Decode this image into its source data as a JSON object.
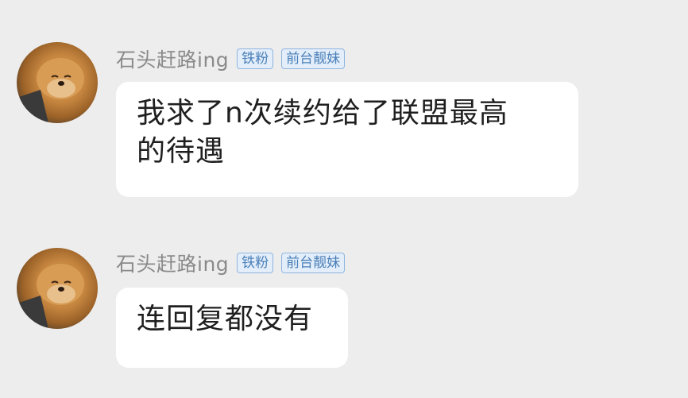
{
  "messages": [
    {
      "username": "石头赶路ing",
      "badges": [
        "铁粉",
        "前台靓妹"
      ],
      "text_lines": [
        "我求了n次续约给了联盟最高",
        "的待遇"
      ]
    },
    {
      "username": "石头赶路ing",
      "badges": [
        "铁粉",
        "前台靓妹"
      ],
      "text_lines": [
        "连回复都没有"
      ]
    }
  ],
  "colors": {
    "background": "#ededed",
    "bubble": "#ffffff",
    "username": "#8a8a8a",
    "badge_text": "#4a7fb8",
    "badge_border": "#8fb5df"
  }
}
